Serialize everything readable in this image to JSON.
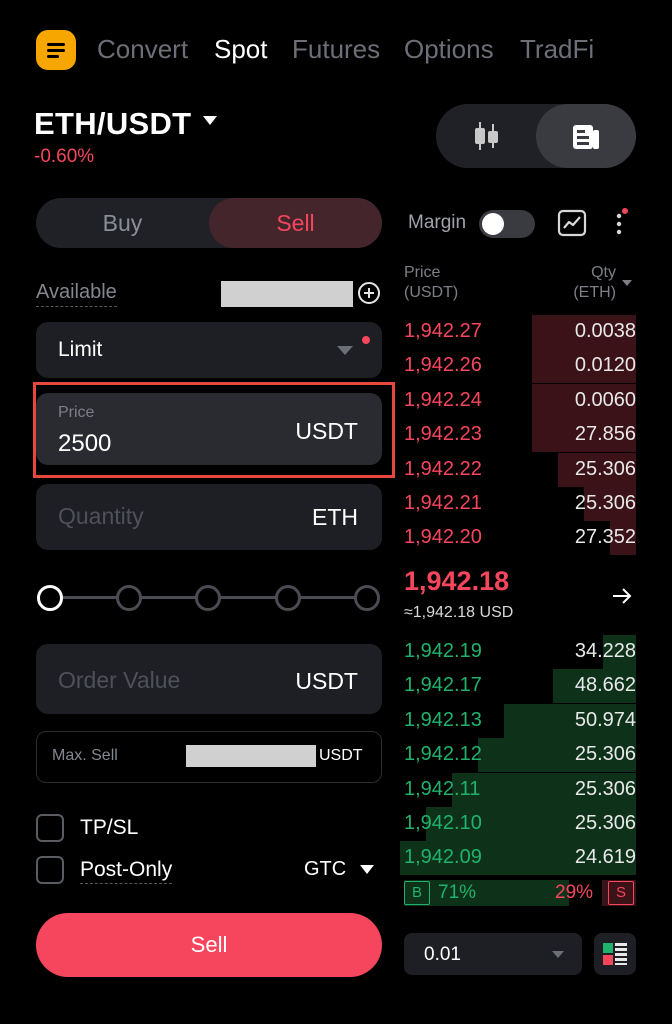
{
  "nav": {
    "tabs": [
      {
        "label": "Convert",
        "active": false
      },
      {
        "label": "Spot",
        "active": true
      },
      {
        "label": "Futures",
        "active": false
      },
      {
        "label": "Options",
        "active": false
      },
      {
        "label": "TradFi",
        "active": false
      }
    ]
  },
  "pair": {
    "symbol": "ETH/USDT",
    "change": "-0.60%"
  },
  "side": {
    "buy_label": "Buy",
    "sell_label": "Sell",
    "selected": "Sell"
  },
  "form": {
    "available_label": "Available",
    "order_type": "Limit",
    "price": {
      "caption": "Price",
      "value": "2500",
      "unit": "USDT"
    },
    "quantity": {
      "placeholder": "Quantity",
      "unit": "ETH"
    },
    "order_value": {
      "placeholder": "Order Value",
      "unit": "USDT"
    },
    "max_sell": {
      "label": "Max. Sell",
      "unit": "USDT"
    },
    "slider_steps": 5,
    "slider_value_fraction": 0,
    "tpsl_label": "TP/SL",
    "postonly_label": "Post-Only",
    "tif": "GTC",
    "submit_label": "Sell"
  },
  "orderbook": {
    "margin_label": "Margin",
    "margin_enabled": false,
    "price_header": [
      "Price",
      "(USDT)"
    ],
    "qty_header": [
      "Qty",
      "(ETH)"
    ],
    "asks": [
      {
        "price": "1,942.27",
        "qty": "0.0038",
        "depth": 0.44
      },
      {
        "price": "1,942.26",
        "qty": "0.0120",
        "depth": 0.44
      },
      {
        "price": "1,942.24",
        "qty": "0.0060",
        "depth": 0.44
      },
      {
        "price": "1,942.23",
        "qty": "27.856",
        "depth": 0.44
      },
      {
        "price": "1,942.22",
        "qty": "25.306",
        "depth": 0.33
      },
      {
        "price": "1,942.21",
        "qty": "25.306",
        "depth": 0.22
      },
      {
        "price": "1,942.20",
        "qty": "27.352",
        "depth": 0.11
      }
    ],
    "last_price": "1,942.18",
    "last_price_usd": "≈1,942.18 USD",
    "bids": [
      {
        "price": "1,942.19",
        "qty": "34.228",
        "depth": 0.14
      },
      {
        "price": "1,942.17",
        "qty": "48.662",
        "depth": 0.35
      },
      {
        "price": "1,942.13",
        "qty": "50.974",
        "depth": 0.56
      },
      {
        "price": "1,942.12",
        "qty": "25.306",
        "depth": 0.67
      },
      {
        "price": "1,942.11",
        "qty": "25.306",
        "depth": 0.78
      },
      {
        "price": "1,942.10",
        "qty": "25.306",
        "depth": 0.89
      },
      {
        "price": "1,942.09",
        "qty": "24.619",
        "depth": 1.0
      }
    ],
    "buy_ratio_badge": "B",
    "buy_ratio": "71%",
    "sell_ratio": "29%",
    "sell_ratio_badge": "S",
    "buy_fraction": 0.71,
    "precision": "0.01"
  },
  "colors": {
    "accent": "#f7a600",
    "sell": "#f6465d",
    "buy": "#20b26c"
  },
  "icons": [
    "menu-icon",
    "candlestick-icon",
    "orderbook-icon",
    "chart-icon",
    "more-icon",
    "plus-circle-icon",
    "arrow-right-icon",
    "layout-icon"
  ]
}
